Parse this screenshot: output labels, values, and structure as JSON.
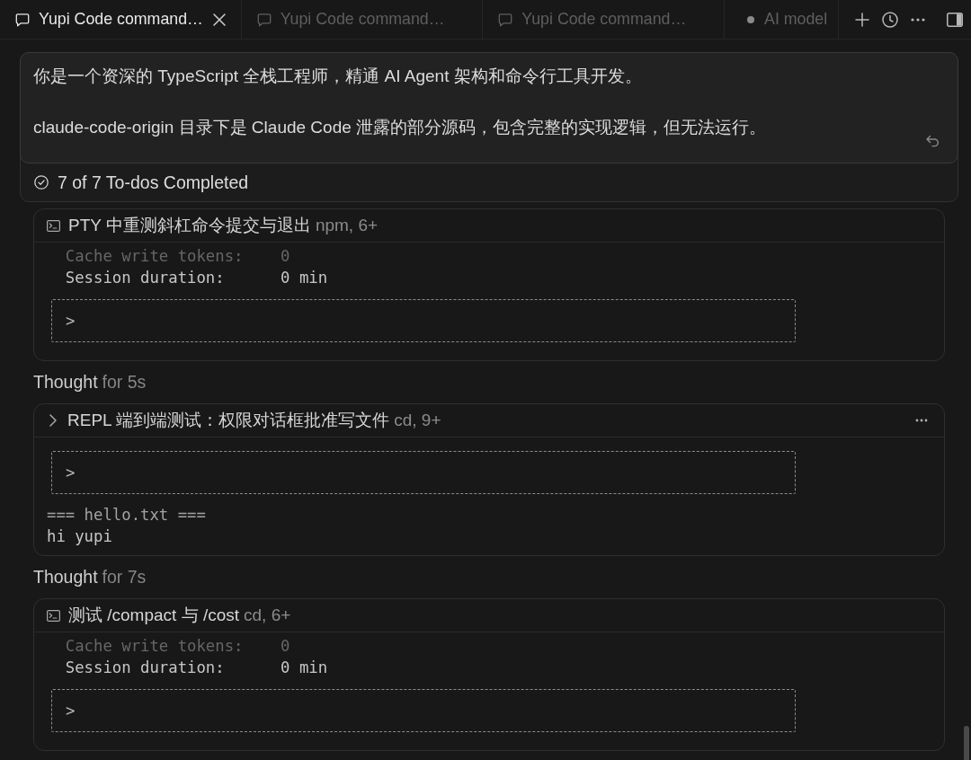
{
  "tabs": [
    {
      "kind": "chat",
      "label": "Yupi Code command…",
      "selected": true
    },
    {
      "kind": "chat",
      "label": "Yupi Code command…",
      "selected": false
    },
    {
      "kind": "chat",
      "label": "Yupi Code command…",
      "selected": false
    },
    {
      "kind": "status",
      "label": "AI model",
      "selected": false
    }
  ],
  "message": {
    "paragraphs": [
      "你是一个资深的 TypeScript 全栈工程师，精通 AI Agent 架构和命令行工具开发。",
      "claude-code-origin 目录下是 Claude Code 泄露的部分源码，包含完整的实现逻辑，但无法运行。"
    ]
  },
  "todos": {
    "summary": "7 of 7 To-dos Completed"
  },
  "items": [
    {
      "kind": "tool",
      "hovered": false,
      "title": "PTY 中重测斜杠命令提交与退出",
      "meta": "npm, 6+",
      "output": [
        {
          "kind": "line",
          "faded": true,
          "dim": false,
          "text": "  Cache write tokens:    0"
        },
        {
          "kind": "line",
          "faded": false,
          "dim": false,
          "text": "  Session duration:      0 min"
        },
        {
          "kind": "prompt",
          "text": ">"
        }
      ]
    },
    {
      "kind": "thought",
      "label": "Thought",
      "duration": "for 5s"
    },
    {
      "kind": "tool",
      "hovered": true,
      "title": "REPL 端到端测试：权限对话框批准写文件",
      "meta": "cd, 9+",
      "output": [
        {
          "kind": "prompt",
          "text": ">"
        },
        {
          "kind": "line",
          "faded": false,
          "dim": true,
          "text": "=== hello.txt ==="
        },
        {
          "kind": "line",
          "faded": false,
          "dim": false,
          "text": "hi yupi"
        }
      ]
    },
    {
      "kind": "thought",
      "label": "Thought",
      "duration": "for 7s"
    },
    {
      "kind": "tool",
      "hovered": false,
      "title": "测试 /compact 与 /cost",
      "meta": "cd, 6+",
      "output": [
        {
          "kind": "line",
          "faded": true,
          "dim": false,
          "text": "  Cache write tokens:    0"
        },
        {
          "kind": "line",
          "faded": false,
          "dim": false,
          "text": "  Session duration:      0 min"
        },
        {
          "kind": "prompt",
          "text": ">"
        }
      ]
    }
  ]
}
